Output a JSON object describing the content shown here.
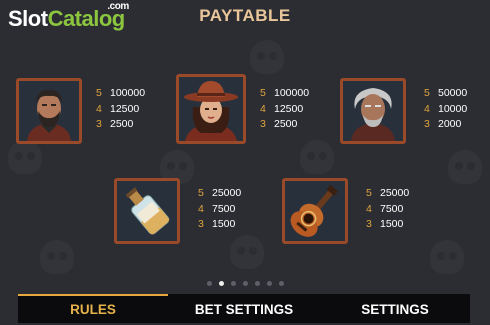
{
  "watermark": {
    "brand_a": "Slot",
    "brand_b": "Catalog",
    "tld": ".com"
  },
  "title": "PAYTABLE",
  "colors": {
    "accent": "#e6b24a",
    "frame": "#9a4a28",
    "count": "#e1a43c"
  },
  "symbols": [
    {
      "icon": "bearded-man-portrait-icon",
      "pays": [
        {
          "count": "5",
          "value": "100000"
        },
        {
          "count": "4",
          "value": "12500"
        },
        {
          "count": "3",
          "value": "2500"
        }
      ]
    },
    {
      "icon": "cowgirl-portrait-icon",
      "pays": [
        {
          "count": "5",
          "value": "100000"
        },
        {
          "count": "4",
          "value": "12500"
        },
        {
          "count": "3",
          "value": "2500"
        }
      ]
    },
    {
      "icon": "old-man-portrait-icon",
      "pays": [
        {
          "count": "5",
          "value": "50000"
        },
        {
          "count": "4",
          "value": "10000"
        },
        {
          "count": "3",
          "value": "2000"
        }
      ]
    },
    {
      "icon": "tequila-bottle-icon",
      "pays": [
        {
          "count": "5",
          "value": "25000"
        },
        {
          "count": "4",
          "value": "7500"
        },
        {
          "count": "3",
          "value": "1500"
        }
      ]
    },
    {
      "icon": "guitar-icon",
      "pays": [
        {
          "count": "5",
          "value": "25000"
        },
        {
          "count": "4",
          "value": "7500"
        },
        {
          "count": "3",
          "value": "1500"
        }
      ]
    }
  ],
  "pagination": {
    "total": 7,
    "active": 2
  },
  "tabs": [
    {
      "label": "RULES",
      "active": true
    },
    {
      "label": "BET SETTINGS",
      "active": false
    },
    {
      "label": "SETTINGS",
      "active": false
    }
  ]
}
